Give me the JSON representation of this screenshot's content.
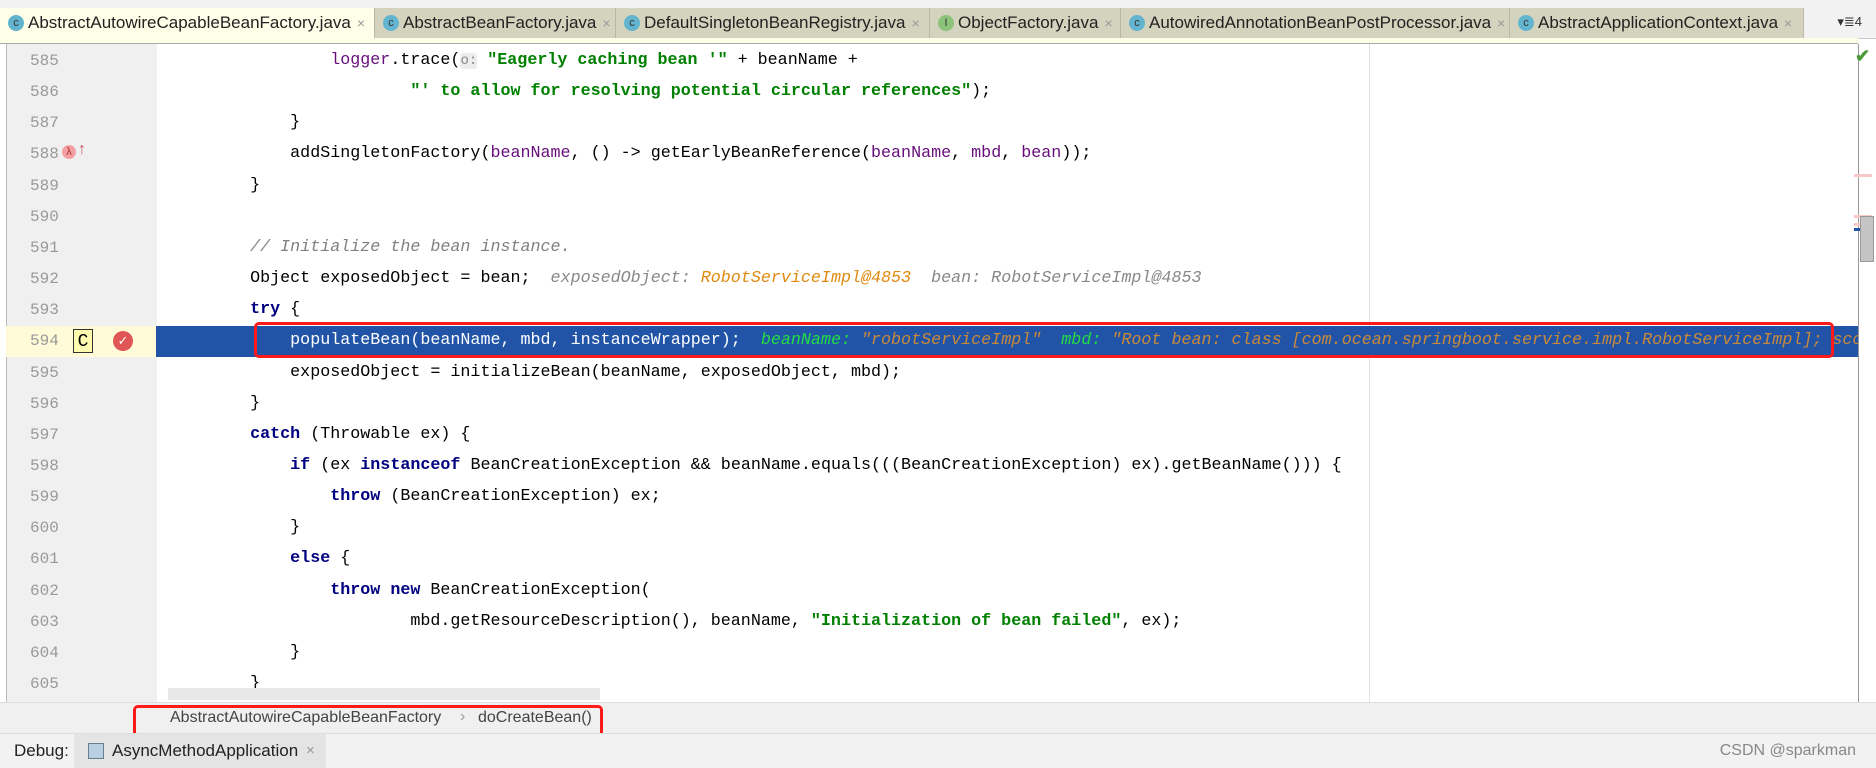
{
  "tabs": [
    {
      "label": "AbstractAutowireCapableBeanFactory.java",
      "icon": "class-icon",
      "glyph": "c",
      "active": true
    },
    {
      "label": "AbstractBeanFactory.java",
      "icon": "class-icon",
      "glyph": "c"
    },
    {
      "label": "DefaultSingletonBeanRegistry.java",
      "icon": "class-icon",
      "glyph": "c"
    },
    {
      "label": "ObjectFactory.java",
      "icon": "interface-icon",
      "glyph": "I"
    },
    {
      "label": "AutowiredAnnotationBeanPostProcessor.java",
      "icon": "class-icon",
      "glyph": "c"
    },
    {
      "label": "AbstractApplicationContext.java",
      "icon": "class-icon",
      "glyph": "c"
    }
  ],
  "tab_overflow": "▾≣4",
  "tab_close": "×",
  "editor": {
    "current_line": 594,
    "lines": [
      {
        "n": "585",
        "t": [
          [
            "                ",
            ""
          ],
          [
            "logger",
            "fld"
          ],
          [
            ".trace(",
            ""
          ],
          [
            "o:",
            "hint"
          ],
          [
            " ",
            ""
          ],
          [
            "\"Eagerly caching bean '\"",
            "str"
          ],
          [
            " + beanName +",
            ""
          ]
        ]
      },
      {
        "n": "586",
        "t": [
          [
            "                        ",
            ""
          ],
          [
            "\"' to allow for resolving potential circular references\"",
            "str"
          ],
          [
            ");",
            ""
          ]
        ]
      },
      {
        "n": "587",
        "t": [
          [
            "            }",
            ""
          ]
        ]
      },
      {
        "n": "588",
        "t": [
          [
            "            addSingletonFactory(",
            ""
          ],
          [
            "beanName",
            "par"
          ],
          [
            ", () -> getEarlyBeanReference(",
            ""
          ],
          [
            "beanName",
            "par"
          ],
          [
            ", ",
            ""
          ],
          [
            "mbd",
            "par"
          ],
          [
            ", ",
            ""
          ],
          [
            "bean",
            "par"
          ],
          [
            "));",
            ""
          ]
        ],
        "gutter": "lambda"
      },
      {
        "n": "589",
        "t": [
          [
            "        }",
            ""
          ]
        ]
      },
      {
        "n": "590",
        "t": []
      },
      {
        "n": "591",
        "t": [
          [
            "        ",
            ""
          ],
          [
            "// Initialize the bean instance.",
            "cm"
          ]
        ]
      },
      {
        "n": "592",
        "t": [
          [
            "        Object exposedObject = bean;  ",
            ""
          ],
          [
            "exposedObject: ",
            "dn"
          ],
          [
            "RobotServiceImpl@4853",
            "dv"
          ],
          [
            "  bean: RobotServiceImpl@4853",
            "dn"
          ]
        ]
      },
      {
        "n": "593",
        "t": [
          [
            "        ",
            ""
          ],
          [
            "try",
            "kw"
          ],
          [
            " {",
            ""
          ]
        ]
      },
      {
        "n": "594",
        "t": [
          [
            "            populateBean(beanName, mbd, instanceWrapper);  ",
            ""
          ],
          [
            "beanName: ",
            "dn"
          ],
          [
            "\"robotServiceImpl\"",
            "dv"
          ],
          [
            "  mbd: ",
            "dn"
          ],
          [
            "\"Root bean: class [com.ocean.springboot.service.impl.RobotServiceImpl]; scope",
            "dv"
          ]
        ],
        "highlight": true
      },
      {
        "n": "595",
        "t": [
          [
            "            exposedObject = initializeBean(beanName, exposedObject, mbd);",
            ""
          ]
        ]
      },
      {
        "n": "596",
        "t": [
          [
            "        }",
            ""
          ]
        ]
      },
      {
        "n": "597",
        "t": [
          [
            "        ",
            ""
          ],
          [
            "catch",
            "kw"
          ],
          [
            " (Throwable ex) {",
            ""
          ]
        ]
      },
      {
        "n": "598",
        "t": [
          [
            "            ",
            ""
          ],
          [
            "if",
            "kw"
          ],
          [
            " (ex ",
            ""
          ],
          [
            "instanceof",
            "kw"
          ],
          [
            " BeanCreationException && beanName.equals(((BeanCreationException) ex).getBeanName())) {",
            ""
          ]
        ]
      },
      {
        "n": "599",
        "t": [
          [
            "                ",
            ""
          ],
          [
            "throw",
            "kw"
          ],
          [
            " (BeanCreationException) ex;",
            ""
          ]
        ]
      },
      {
        "n": "600",
        "t": [
          [
            "            }",
            ""
          ]
        ]
      },
      {
        "n": "601",
        "t": [
          [
            "            ",
            ""
          ],
          [
            "else",
            "kw"
          ],
          [
            " {",
            ""
          ]
        ]
      },
      {
        "n": "602",
        "t": [
          [
            "                ",
            ""
          ],
          [
            "throw new",
            "kw"
          ],
          [
            " BeanCreationException(",
            ""
          ]
        ]
      },
      {
        "n": "603",
        "t": [
          [
            "                        mbd.getResourceDescription(), beanName, ",
            ""
          ],
          [
            "\"Initialization of bean failed\"",
            "str"
          ],
          [
            ", ex);",
            ""
          ]
        ]
      },
      {
        "n": "604",
        "t": [
          [
            "            }",
            ""
          ]
        ]
      },
      {
        "n": "605",
        "t": [
          [
            "        }",
            ""
          ]
        ]
      }
    ]
  },
  "breadcrumb": {
    "class": "AbstractAutowireCapableBeanFactory",
    "separator": "›",
    "method": "doCreateBean()"
  },
  "debug": {
    "label": "Debug:",
    "session": "AsyncMethodApplication",
    "close": "×"
  },
  "watermark": "CSDN @sparkman",
  "colors": {
    "highlight": "#2154a6",
    "annotation_box": "#ff1a1a",
    "keyword": "#000080",
    "string": "#008000"
  }
}
